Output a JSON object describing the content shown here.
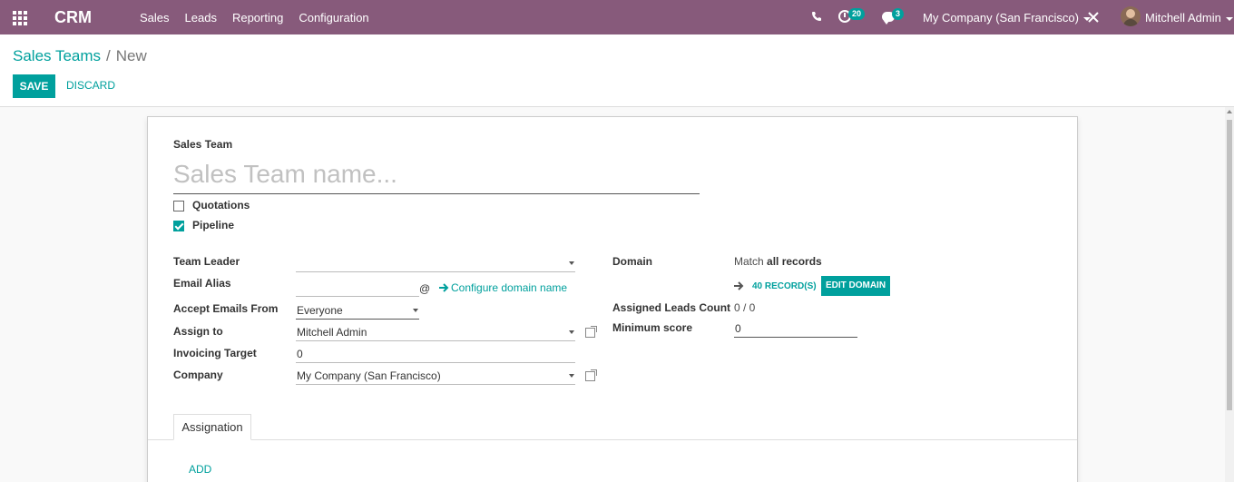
{
  "navbar": {
    "brand": "CRM",
    "menu": [
      "Sales",
      "Leads",
      "Reporting",
      "Configuration"
    ],
    "activities_count": "20",
    "messages_count": "3",
    "company": "My Company (San Francisco)",
    "user": "Mitchell Admin"
  },
  "breadcrumb": {
    "parent": "Sales Teams",
    "separator": "/",
    "current": "New"
  },
  "actions": {
    "save": "SAVE",
    "discard": "DISCARD"
  },
  "form": {
    "team_label": "Sales Team",
    "name_placeholder": "Sales Team name...",
    "quotations_label": "Quotations",
    "pipeline_label": "Pipeline",
    "team_leader_label": "Team Leader",
    "team_leader_value": "",
    "email_alias_label": "Email Alias",
    "email_alias_value": "",
    "at_sign": "@",
    "configure_domain": "Configure domain name",
    "accept_emails_label": "Accept Emails From",
    "accept_emails_value": "Everyone",
    "assign_to_label": "Assign to",
    "assign_to_value": "Mitchell Admin",
    "invoicing_target_label": "Invoicing Target",
    "invoicing_target_value": "0",
    "company_label": "Company",
    "company_value": "My Company (San Francisco)",
    "domain_label": "Domain",
    "domain_match_prefix": "Match",
    "domain_match_value": "all records",
    "records_link": "40 RECORD(S)",
    "edit_domain": "EDIT DOMAIN",
    "assigned_leads_label": "Assigned Leads Count",
    "assigned_leads_value": "0 / 0",
    "minimum_score_label": "Minimum score",
    "minimum_score_value": "0"
  },
  "tabs": {
    "assignation": "Assignation",
    "add": "ADD"
  },
  "colors": {
    "navbar": "#875a7b",
    "accent": "#00a09d"
  }
}
